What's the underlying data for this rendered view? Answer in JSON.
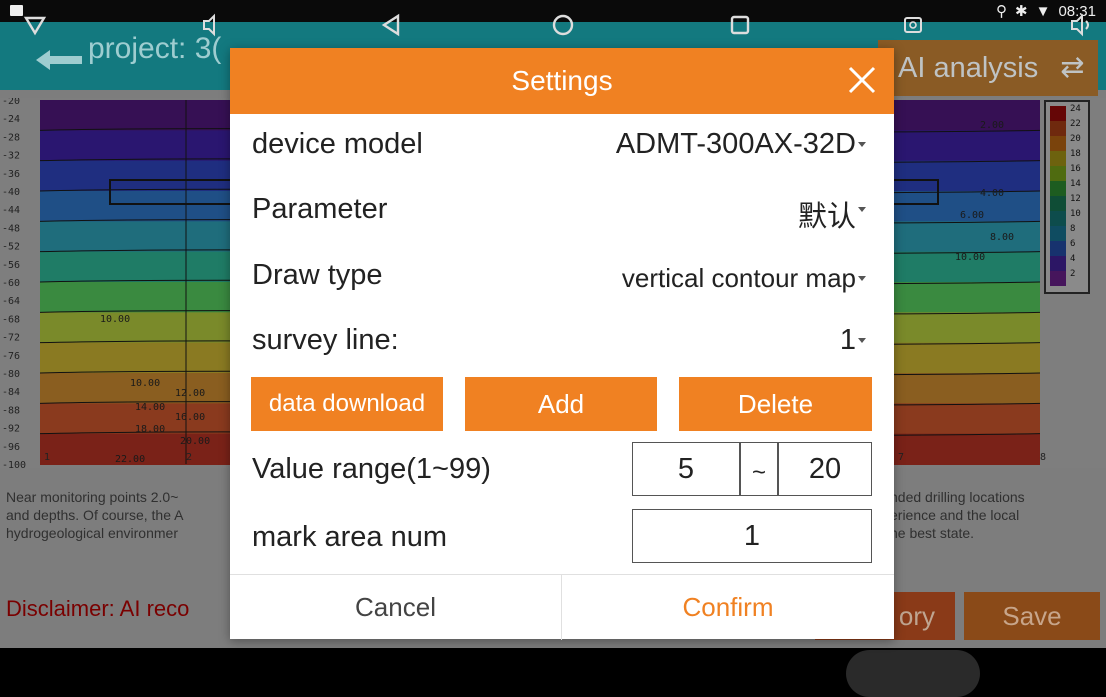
{
  "status_bar": {
    "time": "08:31"
  },
  "app_bar": {
    "title": "project: 3(",
    "ai_analysis": "AI analysis"
  },
  "chart_data": {
    "type": "heatmap",
    "y_ticks": [
      "-20",
      "-24",
      "-28",
      "-32",
      "-36",
      "-40",
      "-44",
      "-48",
      "-52",
      "-56",
      "-60",
      "-64",
      "-68",
      "-72",
      "-76",
      "-80",
      "-84",
      "-88",
      "-92",
      "-96",
      "-100"
    ],
    "x_ticks": [
      "1",
      "2",
      "7",
      "8"
    ],
    "contour_labels": [
      "2.00",
      "4.00",
      "6.00",
      "8.00",
      "10.00",
      "10.00",
      "10.00",
      "12.00",
      "14.00",
      "16.00",
      "18.00",
      "20.00",
      "22.00"
    ],
    "legend": [
      "24",
      "22",
      "20",
      "18",
      "16",
      "14",
      "12",
      "10",
      "8",
      "6",
      "4",
      "2"
    ],
    "legend_colors": [
      "#b80b0b",
      "#c94a1a",
      "#dd7a15",
      "#c7b31a",
      "#8fc21e",
      "#35a83b",
      "#1c8c63",
      "#178a8a",
      "#1b8ab0",
      "#2a5ac8",
      "#5028b7",
      "#7f27a8"
    ]
  },
  "bottom": {
    "text_left_1": "Near monitoring points 2.0~",
    "text_left_2": "and depths. Of course, the A",
    "text_left_3": "hydrogeological environmer",
    "text_right_1": "nded drilling locations",
    "text_right_2": "erience and the local",
    "text_right_3": "he best state.",
    "disclaimer": "Disclaimer: AI reco",
    "history_label": "ory",
    "save_label": "Save"
  },
  "dialog": {
    "title": "Settings",
    "device_model_label": "device model",
    "device_model_value": "ADMT-300AX-32D",
    "parameter_label": "Parameter",
    "parameter_value": "默认",
    "draw_type_label": "Draw type",
    "draw_type_value": "vertical contour map",
    "survey_line_label": "survey line:",
    "survey_line_value": "1",
    "btn_data_download": "data download",
    "btn_add": "Add",
    "btn_delete": "Delete",
    "value_range_label": "Value range(1~99)",
    "value_range_min": "5",
    "value_range_sep": "~",
    "value_range_max": "20",
    "mark_area_label": "mark area num",
    "mark_area_value": "1",
    "cancel": "Cancel",
    "confirm": "Confirm"
  }
}
